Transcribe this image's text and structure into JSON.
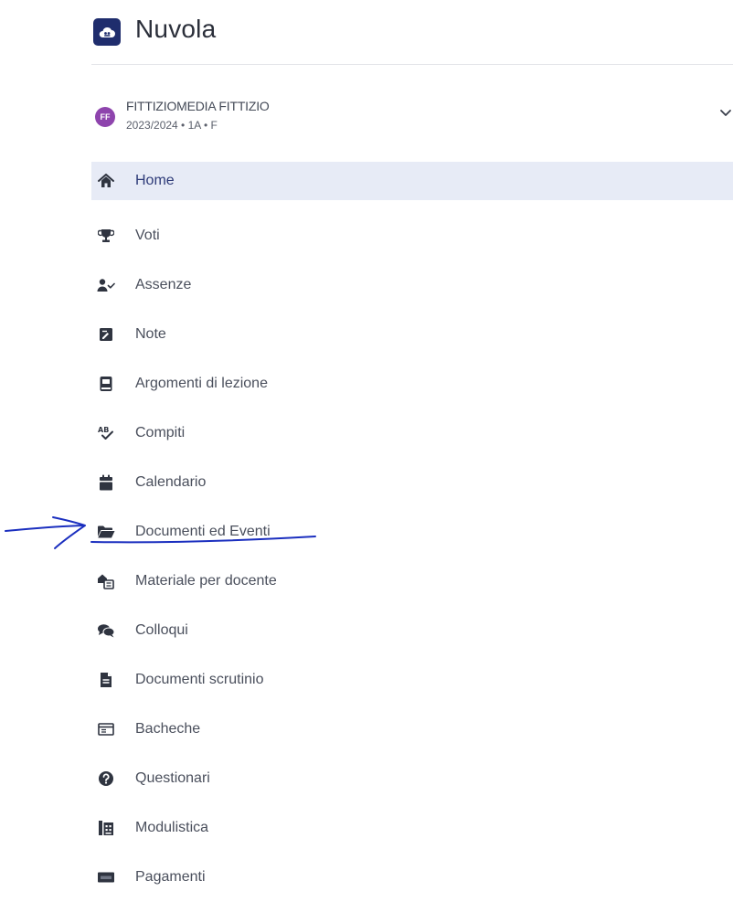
{
  "app": {
    "title": "Nuvola"
  },
  "user": {
    "initials": "FF",
    "name": "FITTIZIOMEDIA FITTIZIO",
    "meta": "2023/2024 • 1A • F"
  },
  "nav": {
    "items": [
      {
        "label": "Home",
        "icon": "home-icon"
      },
      {
        "label": "Voti",
        "icon": "trophy-icon"
      },
      {
        "label": "Assenze",
        "icon": "user-check-icon"
      },
      {
        "label": "Note",
        "icon": "note-icon"
      },
      {
        "label": "Argomenti di lezione",
        "icon": "book-icon"
      },
      {
        "label": "Compiti",
        "icon": "spellcheck-icon"
      },
      {
        "label": "Calendario",
        "icon": "calendar-icon"
      },
      {
        "label": "Documenti ed Eventi",
        "icon": "folder-open-icon"
      },
      {
        "label": "Materiale per docente",
        "icon": "material-icon"
      },
      {
        "label": "Colloqui",
        "icon": "comments-icon"
      },
      {
        "label": "Documenti scrutinio",
        "icon": "file-icon"
      },
      {
        "label": "Bacheche",
        "icon": "board-icon"
      },
      {
        "label": "Questionari",
        "icon": "question-circle-icon"
      },
      {
        "label": "Modulistica",
        "icon": "forms-icon"
      },
      {
        "label": "Pagamenti",
        "icon": "payment-icon"
      }
    ]
  },
  "colors": {
    "brand": "#1f2d6d",
    "avatar": "#8e44ad",
    "active_bg": "#e7ebf6",
    "annotation_ink": "#1b2fbf"
  }
}
